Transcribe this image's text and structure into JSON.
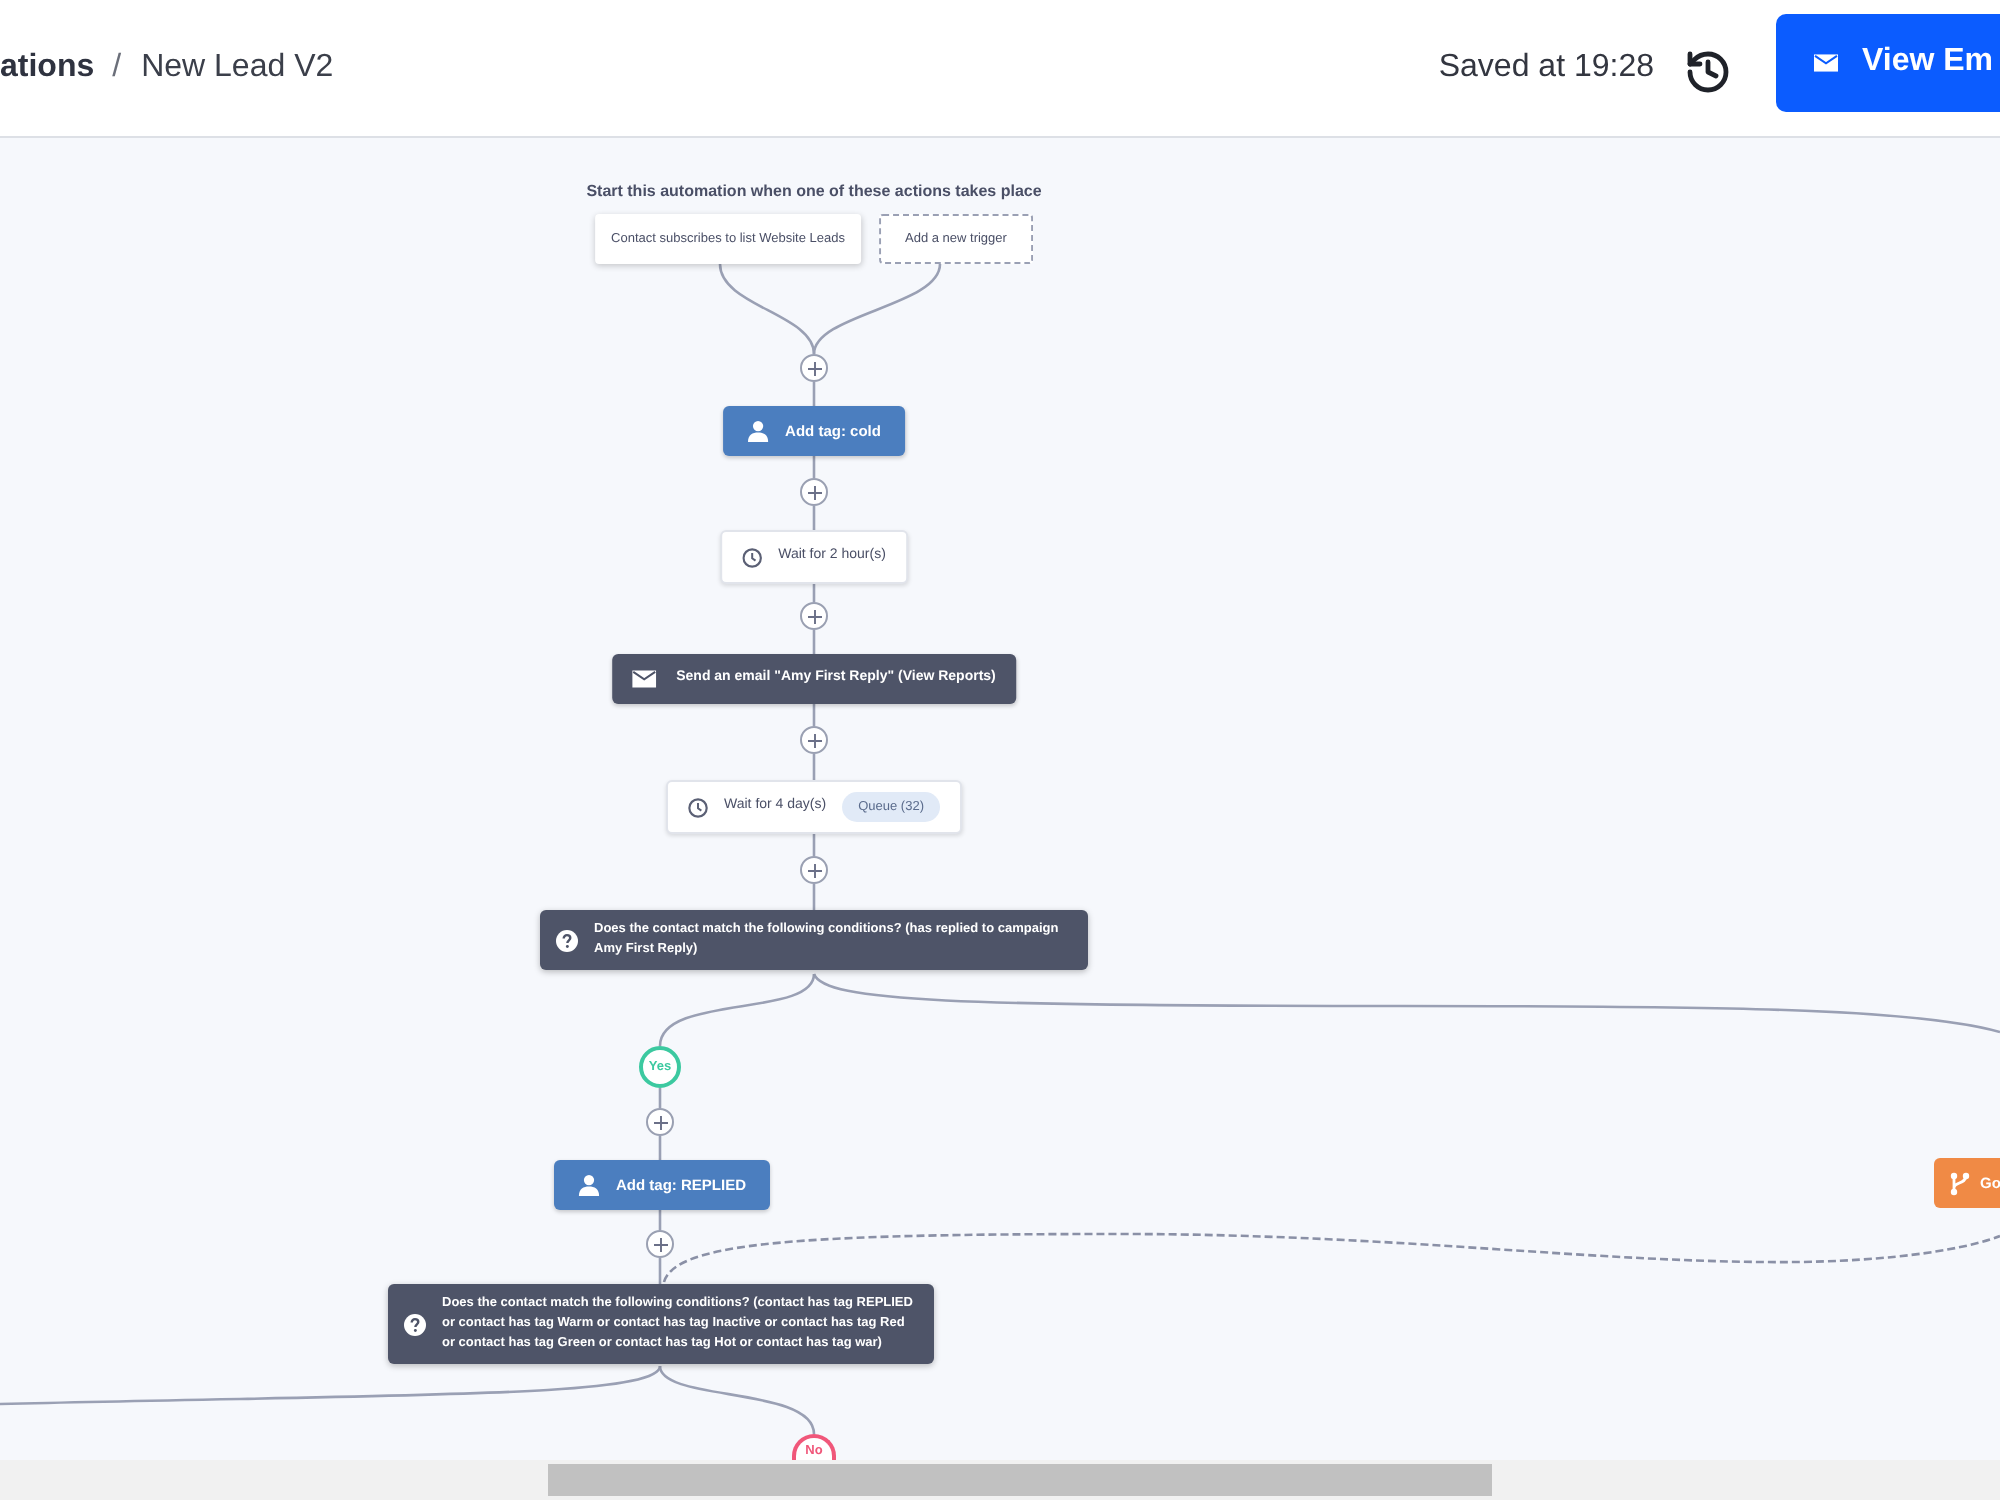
{
  "header": {
    "breadcrumb": {
      "parent": "ations",
      "separator": "/",
      "current": "New Lead V2"
    },
    "saved_status": "Saved at 19:28",
    "primary_button": {
      "label": "View Em"
    }
  },
  "canvas": {
    "trigger_heading": "Start this automation when one of these actions takes place",
    "triggers": [
      {
        "kind": "trigger",
        "label": "Contact subscribes to list Website Leads"
      },
      {
        "kind": "add",
        "label": "Add a new trigger"
      }
    ],
    "steps": [
      {
        "kind": "tag",
        "label": "Add tag: cold"
      },
      {
        "kind": "wait",
        "label": "Wait for 2 hour(s)"
      },
      {
        "kind": "email",
        "label": "Send an email \"Amy First Reply\" (View Reports)"
      },
      {
        "kind": "wait",
        "label": "Wait for 4 day(s)",
        "badge": "Queue (32)"
      },
      {
        "kind": "condition",
        "label": "Does the contact match the following conditions? (has replied to campaign Amy First Reply)"
      },
      {
        "kind": "branch_label",
        "color": "#3cc9a0",
        "label": "Yes"
      },
      {
        "kind": "tag",
        "label": "Add tag: REPLIED"
      },
      {
        "kind": "goto",
        "label": "Go"
      },
      {
        "kind": "condition",
        "label": "Does the contact match the following conditions? (contact has tag REPLIED or contact has tag Warm or contact has tag Inactive or contact has tag Red or contact has tag Green or contact has tag Hot or contact has tag war)"
      },
      {
        "kind": "branch_label",
        "color": "#f0577a",
        "label": "No"
      }
    ]
  }
}
